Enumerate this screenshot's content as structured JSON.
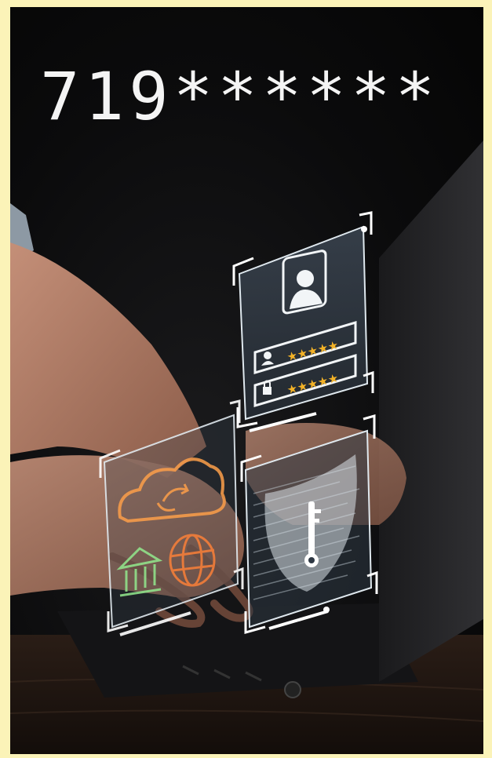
{
  "caption": {
    "code": "719******"
  },
  "icons": {
    "profile": "user-avatar-icon",
    "username": "user-icon",
    "password": "lock-icon",
    "shield": "shield-key-icon",
    "cloud": "cloud-sync-icon",
    "bank": "bank-icon",
    "globe": "globe-icon"
  },
  "ratings": {
    "username_stars": 5,
    "password_stars": 5
  },
  "colors": {
    "frame": "#fbf3b8",
    "background": "#080808",
    "hologram": "#e8f0f4",
    "stars": "#f3b227",
    "cloud": "#f29a4a",
    "bank": "#8ee08a",
    "globe": "#f07d3a"
  }
}
